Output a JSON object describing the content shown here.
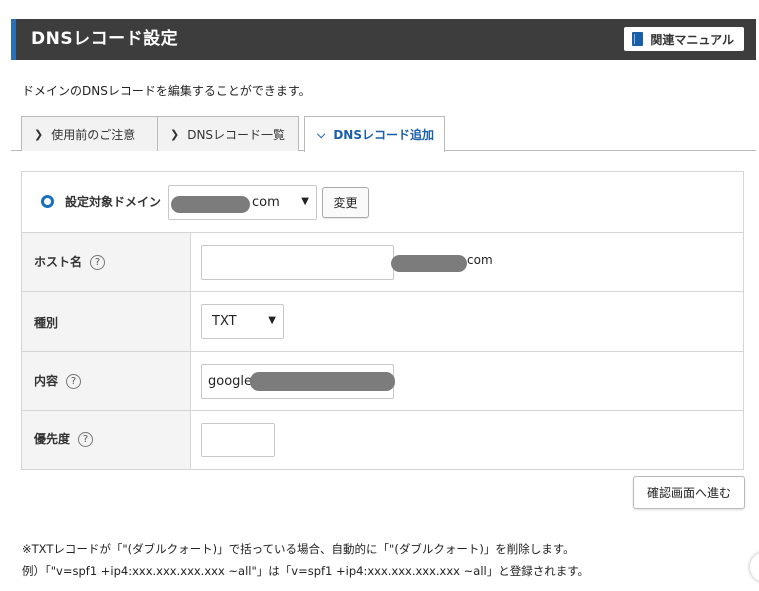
{
  "header": {
    "title": "DNSレコード設定",
    "manual_label": "関連マニュアル"
  },
  "description": "ドメインのDNSレコードを編集することができます。",
  "tabs": [
    {
      "label": "使用前のご注意",
      "active": false
    },
    {
      "label": "DNSレコード一覧",
      "active": false
    },
    {
      "label": "DNSレコード追加",
      "active": true
    }
  ],
  "domain": {
    "label": "設定対象ドメイン",
    "selected_suffix": "com",
    "change_label": "変更"
  },
  "form": {
    "host": {
      "label": "ホスト名",
      "help": "?",
      "value": "",
      "suffix": "com"
    },
    "type": {
      "label": "種別",
      "selected": "TXT"
    },
    "content": {
      "label": "内容",
      "help": "?",
      "value": "google"
    },
    "priority": {
      "label": "優先度",
      "help": "?",
      "value": ""
    }
  },
  "confirm_label": "確認画面へ進む",
  "notes": [
    "※TXTレコードが「\"(ダブルクォート)」で括っている場合、自動的に「\"(ダブルクォート)」を削除します。",
    "例）「\"v=spf1 +ip4:xxx.xxx.xxx.xxx ~all\"」は「v=spf1 +ip4:xxx.xxx.xxx.xxx ~all」と登録されます。"
  ],
  "colors": {
    "header_bg": "#3d3d3d",
    "accent": "#2b6fb7",
    "active_tab": "#1a5fa8"
  }
}
